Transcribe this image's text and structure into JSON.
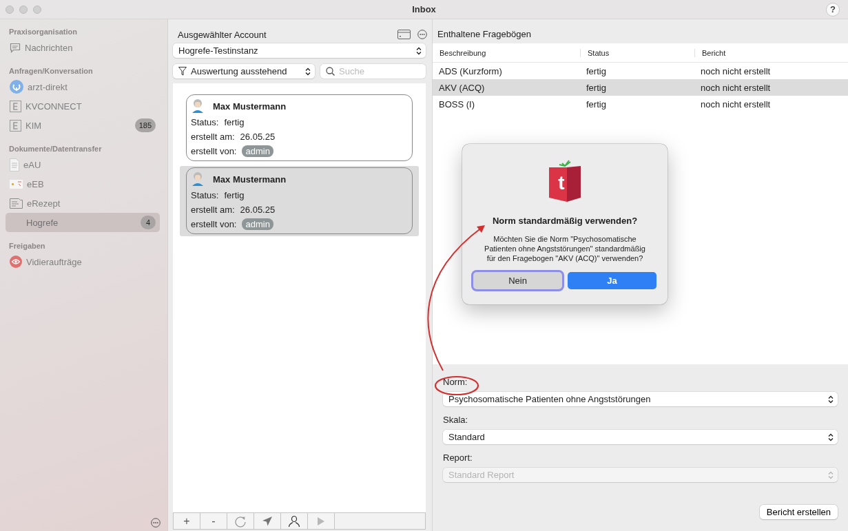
{
  "window": {
    "title": "Inbox",
    "help": "?"
  },
  "sidebar": {
    "sections": [
      {
        "title": "Praxisorganisation",
        "items": [
          {
            "label": "Nachrichten",
            "kind": "chat",
            "selected": false
          }
        ]
      },
      {
        "title": "Anfragen/Konversation",
        "items": [
          {
            "label": "arzt-direkt",
            "kind": "plug",
            "selected": false
          },
          {
            "label": "KVCONNECT",
            "kind": "e",
            "selected": false
          },
          {
            "label": "KIM",
            "kind": "e",
            "badge": "185",
            "selected": false
          }
        ]
      },
      {
        "title": "Dokumente/Datentransfer",
        "items": [
          {
            "label": "eAU",
            "kind": "doc",
            "selected": false
          },
          {
            "label": "eEB",
            "kind": "card",
            "selected": false
          },
          {
            "label": "eRezept",
            "kind": "receipt",
            "selected": false
          },
          {
            "label": "Hogrefe",
            "kind": "plain",
            "badge": "4",
            "selected": true
          }
        ]
      },
      {
        "title": "Freigaben",
        "items": [
          {
            "label": "Vidieraufträge",
            "kind": "eye",
            "selected": false
          }
        ]
      }
    ]
  },
  "middle": {
    "title": "Ausgewählter Account",
    "account": "Hogrefe-Testinstanz",
    "filter": "Auswertung ausstehend",
    "search": {
      "placeholder": "Suche"
    },
    "cards": [
      {
        "name": "Max Mustermann",
        "status_label": "Status:",
        "status": "fertig",
        "created_label": "erstellt am:",
        "created": "26.05.25",
        "by_label": "erstellt von:",
        "by": "admin",
        "selected": false
      },
      {
        "name": "Max Mustermann",
        "status_label": "Status:",
        "status": "fertig",
        "created_label": "erstellt am:",
        "created": "26.05.25",
        "by_label": "erstellt von:",
        "by": "admin",
        "selected": true
      }
    ],
    "toolbar": [
      {
        "kind": "text",
        "label": "+",
        "disabled": false
      },
      {
        "kind": "text",
        "label": "-",
        "disabled": false
      },
      {
        "kind": "refresh",
        "disabled": false
      },
      {
        "kind": "send",
        "disabled": false
      },
      {
        "kind": "person",
        "disabled": false
      },
      {
        "kind": "play",
        "disabled": true
      }
    ]
  },
  "right": {
    "title": "Enthaltene Fragebögen",
    "table": {
      "columns": [
        "Beschreibung",
        "Status",
        "Bericht"
      ],
      "rows": [
        {
          "cells": [
            "ADS (Kurzform)",
            "fertig",
            "noch nicht erstellt"
          ],
          "selected": false
        },
        {
          "cells": [
            "AKV (ACQ)",
            "fertig",
            "noch nicht erstellt"
          ],
          "selected": true
        },
        {
          "cells": [
            "BOSS (I)",
            "fertig",
            "noch nicht erstellt"
          ],
          "selected": false
        }
      ]
    },
    "fields": [
      {
        "label": "Norm:",
        "value": "Psychosomatische Patienten ohne Angststörungen",
        "disabled": false
      },
      {
        "label": "Skala:",
        "value": "Standard",
        "disabled": false
      },
      {
        "label": "Report:",
        "value": "Standard Report",
        "disabled": true
      }
    ],
    "button": "Bericht erstellen"
  },
  "dialog": {
    "title": "Norm standardmäßig verwenden?",
    "logo": "t",
    "message": "Möchten Sie die Norm \"Psychosomatische Patienten ohne Angststörungen\" standardmäßig für den Fragebogen \"AKV (ACQ)\" verwenden?",
    "buttons": [
      {
        "label": "Nein",
        "default": false,
        "focused": true
      },
      {
        "label": "Ja",
        "default": true,
        "focused": false
      }
    ]
  }
}
